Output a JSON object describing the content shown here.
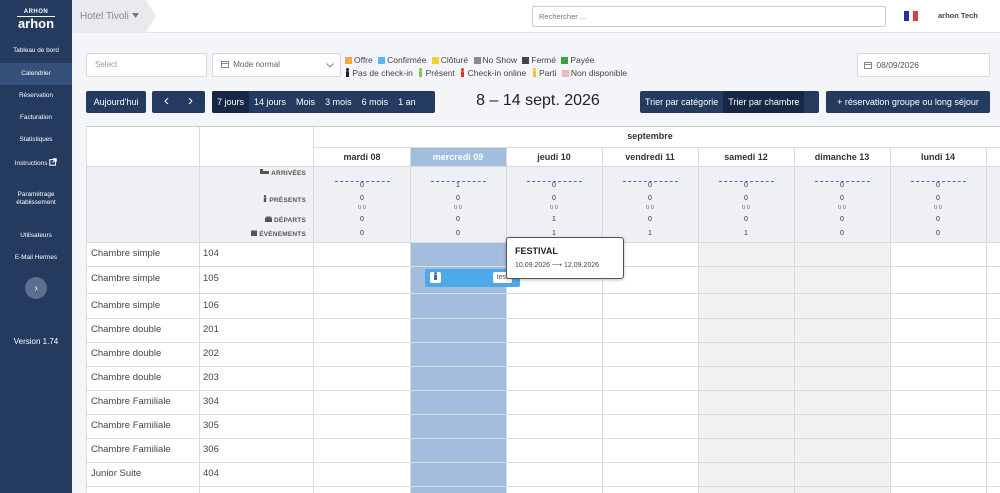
{
  "sidebar": {
    "logo_small": "ARHON",
    "logo": "arhon",
    "items": [
      {
        "label": "Tableau de bord"
      },
      {
        "label": "Calendrier"
      },
      {
        "label": "Réservation"
      },
      {
        "label": "Facturation"
      },
      {
        "label": "Statistiques"
      },
      {
        "label": "Instructions"
      },
      {
        "label": "Paramétrage"
      },
      {
        "label": "établissement"
      },
      {
        "label": "Utilisateurs"
      },
      {
        "label": "E-Mail Hermes"
      }
    ],
    "expand_glyph": "›",
    "version": "Version 1.74"
  },
  "topbar": {
    "hotel": "Hotel Tivoli",
    "search_placeholder": "Rechercher ...",
    "flag_colors": [
      "#1f3a93",
      "#ffffff",
      "#e03a3e"
    ],
    "user": "arhon Tech"
  },
  "filters": {
    "select_placeholder": "Select",
    "mode": "Mode normal",
    "date": "08/09/2026"
  },
  "legend": {
    "row1": [
      {
        "label": "Offre",
        "color": "#f5a742"
      },
      {
        "label": "Confirmée",
        "color": "#5ab5f0"
      },
      {
        "label": "Clôturé",
        "color": "#f2d230"
      },
      {
        "label": "No Show",
        "color": "#8a8a8a"
      },
      {
        "label": "Fermé",
        "color": "#444444"
      },
      {
        "label": "Payée",
        "color": "#3aa23a"
      }
    ],
    "row2": [
      {
        "label": "Pas de check-in",
        "color": "#222222"
      },
      {
        "label": "Présent",
        "color": "#7cc84a"
      },
      {
        "label": "Check-in online",
        "color": "#e0302f"
      },
      {
        "label": "Parti",
        "color": "#f2c230"
      },
      {
        "label": "Non disponible",
        "color": "#f0b8b8"
      }
    ]
  },
  "controls": {
    "today": "Aujourd'hui",
    "prev": "‹",
    "next": "›",
    "views": [
      "7 jours",
      "14 jours",
      "Mois",
      "3 mois",
      "6 mois",
      "1 an"
    ],
    "range": "8 – 14 sept. 2026",
    "sort_category": "Trier par catégorie",
    "sort_room": "Trier par chambre",
    "group_button": "+ réservation groupe ou long séjour"
  },
  "calendar": {
    "month": "septembre",
    "days": [
      "mardi 08",
      "mercredi 09",
      "jeudi 10",
      "vendredi 11",
      "samedi 12",
      "dimanche 13",
      "lundi 14"
    ],
    "stat_labels": {
      "arrivals": "ARRIVÉES",
      "present": "PRÉSENTS",
      "departures": "DÉPARTS",
      "events": "ÉVÈNEMENTS"
    },
    "arrivals": [
      "0",
      "1",
      "0",
      "0",
      "0",
      "0",
      "0"
    ],
    "present": [
      "0",
      "0",
      "0",
      "0",
      "0",
      "0",
      "0"
    ],
    "present_sub": [
      "0 0",
      "0 0",
      "0 0",
      "0 0",
      "0 0",
      "0 0",
      "0 0"
    ],
    "departures": [
      "0",
      "0",
      "1",
      "0",
      "0",
      "0",
      "0"
    ],
    "events": [
      "0",
      "0",
      "1",
      "1",
      "1",
      "0",
      "0"
    ],
    "rooms": [
      {
        "category": "Chambre simple",
        "number": "104"
      },
      {
        "category": "Chambre simple",
        "number": "105"
      },
      {
        "category": "Chambre simple",
        "number": "106"
      },
      {
        "category": "Chambre double",
        "number": "201"
      },
      {
        "category": "Chambre double",
        "number": "202"
      },
      {
        "category": "Chambre double",
        "number": "203"
      },
      {
        "category": "Chambre Familiale",
        "number": "304"
      },
      {
        "category": "Chambre Familiale",
        "number": "305"
      },
      {
        "category": "Chambre Familiale",
        "number": "306"
      },
      {
        "category": "Junior Suite",
        "number": "404"
      }
    ],
    "booking": {
      "label": "test"
    },
    "tooltip": {
      "title": "FESTIVAL",
      "dates": "10.09.2026 ⟶ 12.09.2026"
    }
  }
}
